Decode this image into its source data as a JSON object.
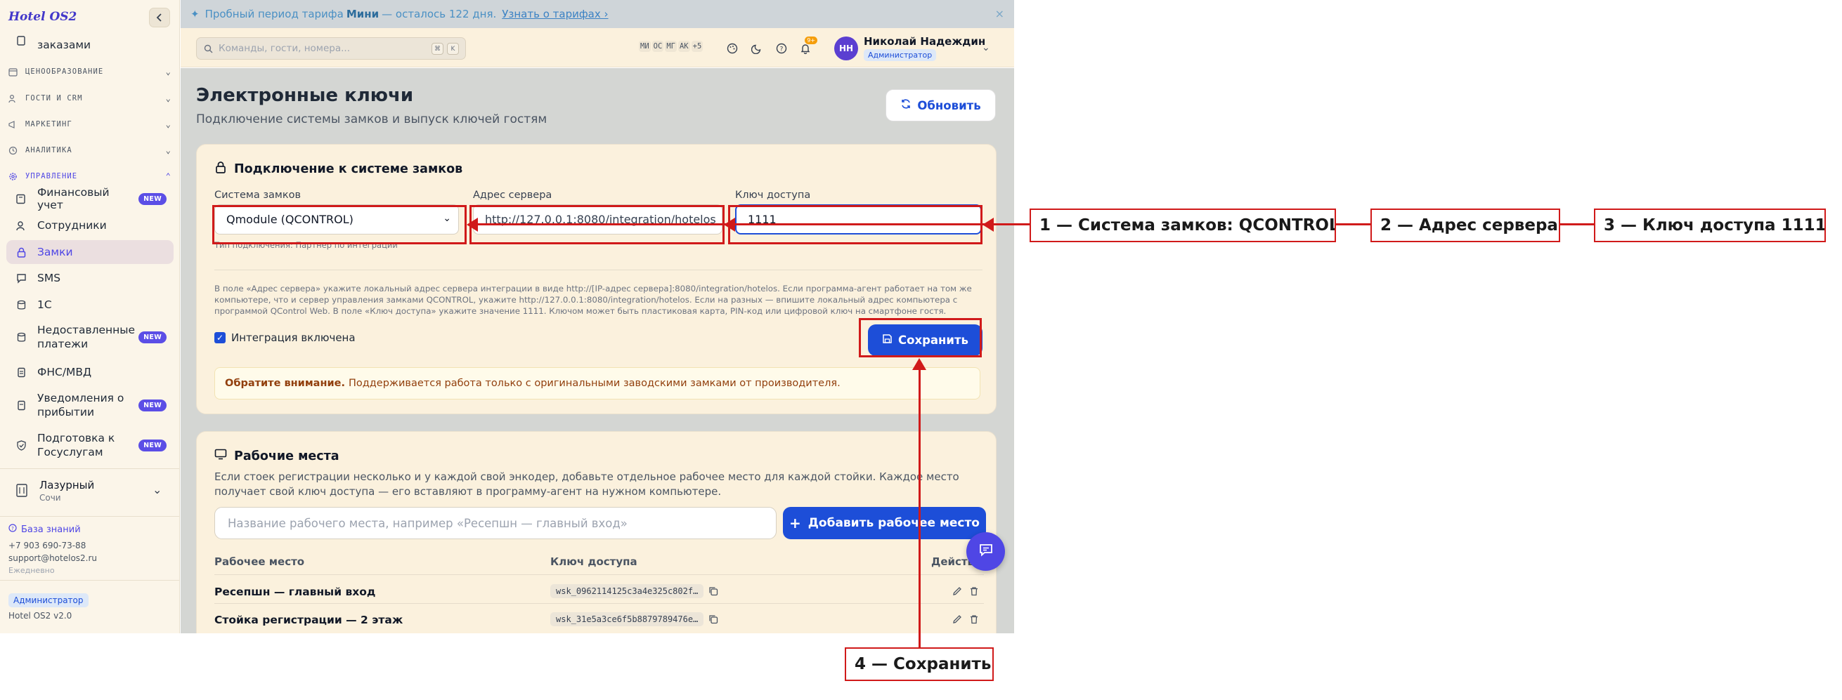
{
  "app": {
    "logo": "Hotel OS2"
  },
  "sidebar": {
    "partial_item": "заказами",
    "sections": [
      {
        "label": "ЦЕНООБРАЗОВАНИЕ"
      },
      {
        "label": "ГОСТИ И CRM"
      },
      {
        "label": "МАРКЕТИНГ"
      },
      {
        "label": "АНАЛИТИКА"
      },
      {
        "label": "УПРАВЛЕНИЕ"
      }
    ],
    "items": [
      {
        "label": "Финансовый учет",
        "badge": "NEW"
      },
      {
        "label": "Сотрудники"
      },
      {
        "label": "Замки"
      },
      {
        "label": "SMS"
      },
      {
        "label": "1С"
      },
      {
        "label": "Недоставленные платежи",
        "badge": "NEW"
      },
      {
        "label": "ФНС/МВД"
      },
      {
        "label": "Уведомления о прибытии",
        "badge": "NEW"
      },
      {
        "label": "Подготовка к Госуслугам",
        "badge": "NEW"
      }
    ],
    "property": {
      "name": "Лазурный",
      "city": "Сочи"
    },
    "footer": {
      "kb": "База знаний",
      "phone": "+7 903 690-73-88",
      "email": "support@hotelos2.ru",
      "hours": "Ежедневно",
      "role": "Администратор",
      "version": "Hotel OS2 v2.0"
    }
  },
  "banner": {
    "prefix": "Пробный период тарифа",
    "plan": "Мини",
    "suffix": "— осталось 122 дня.",
    "link": "Узнать о тарифах ›",
    "close": "×"
  },
  "header": {
    "search_placeholder": "Команды, гости, номера...",
    "kbd1": "⌘",
    "kbd2": "K",
    "presence": [
      "МИ",
      "ОС",
      "МГ",
      "АК",
      "+5"
    ],
    "bell_count": "9+",
    "avatar": "НН",
    "user_name": "Николай Надеждин",
    "user_role": "Администратор"
  },
  "page": {
    "title": "Электронные ключи",
    "subtitle": "Подключение системы замков и выпуск ключей гостям",
    "refresh": "Обновить"
  },
  "lock_card": {
    "title": "Подключение к системе замков",
    "system_label": "Система замков",
    "system_value": "Qmodule (QCONTROL)",
    "server_label": "Адрес сервера",
    "server_value": "http://127.0.0.1:8080/integration/hotelos",
    "key_label": "Ключ доступа",
    "key_value": "1111",
    "conn_type": "Тип подключения: Партнер по интеграции",
    "info": "В поле «Адрес сервера» укажите локальный адрес сервера интеграции в виде http://[IP-адрес сервера]:8080/integration/hotelos. Если программа-агент работает на том же компьютере, что и сервер управления замками QCONTROL, укажите http://127.0.0.1:8080/integration/hotelos. Если на разных — впишите локальный адрес компьютера с программой QControl Web. В поле «Ключ доступа» укажите значение 1111. Ключом может быть пластиковая карта, PIN-код или цифровой ключ на смартфоне гостя.",
    "checkbox_label": "Интеграция включена",
    "save": "Сохранить",
    "warn_bold": "Обратите внимание.",
    "warn_text": "Поддерживается работа только с оригинальными заводскими замками от производителя."
  },
  "workplaces": {
    "title": "Рабочие места",
    "desc": "Если стоек регистрации несколько и у каждой свой энкодер, добавьте отдельное рабочее место для каждой стойки. Каждое место получает свой ключ доступа — его вставляют в программу-агент на нужном компьютере.",
    "input_placeholder": "Название рабочего места, например «Ресепшн — главный вход»",
    "add": "Добавить рабочее место",
    "col_place": "Рабочее место",
    "col_key": "Ключ доступа",
    "col_action": "Действия",
    "rows": [
      {
        "name": "Ресепшн — главный вход",
        "key": "wsk_0962114125c3a4e325c802f…"
      },
      {
        "name": "Стойка регистрации — 2 этаж",
        "key": "wsk_31e5a3ce6f5b8879789476e…"
      }
    ]
  },
  "annotations": {
    "a1": "1 — Система замков: QCONTROL",
    "a2": "2 — Адрес сервера",
    "a3": "3 — Ключ доступа 1111",
    "a4": "4 — Сохранить",
    "color": "#d01a1a"
  }
}
